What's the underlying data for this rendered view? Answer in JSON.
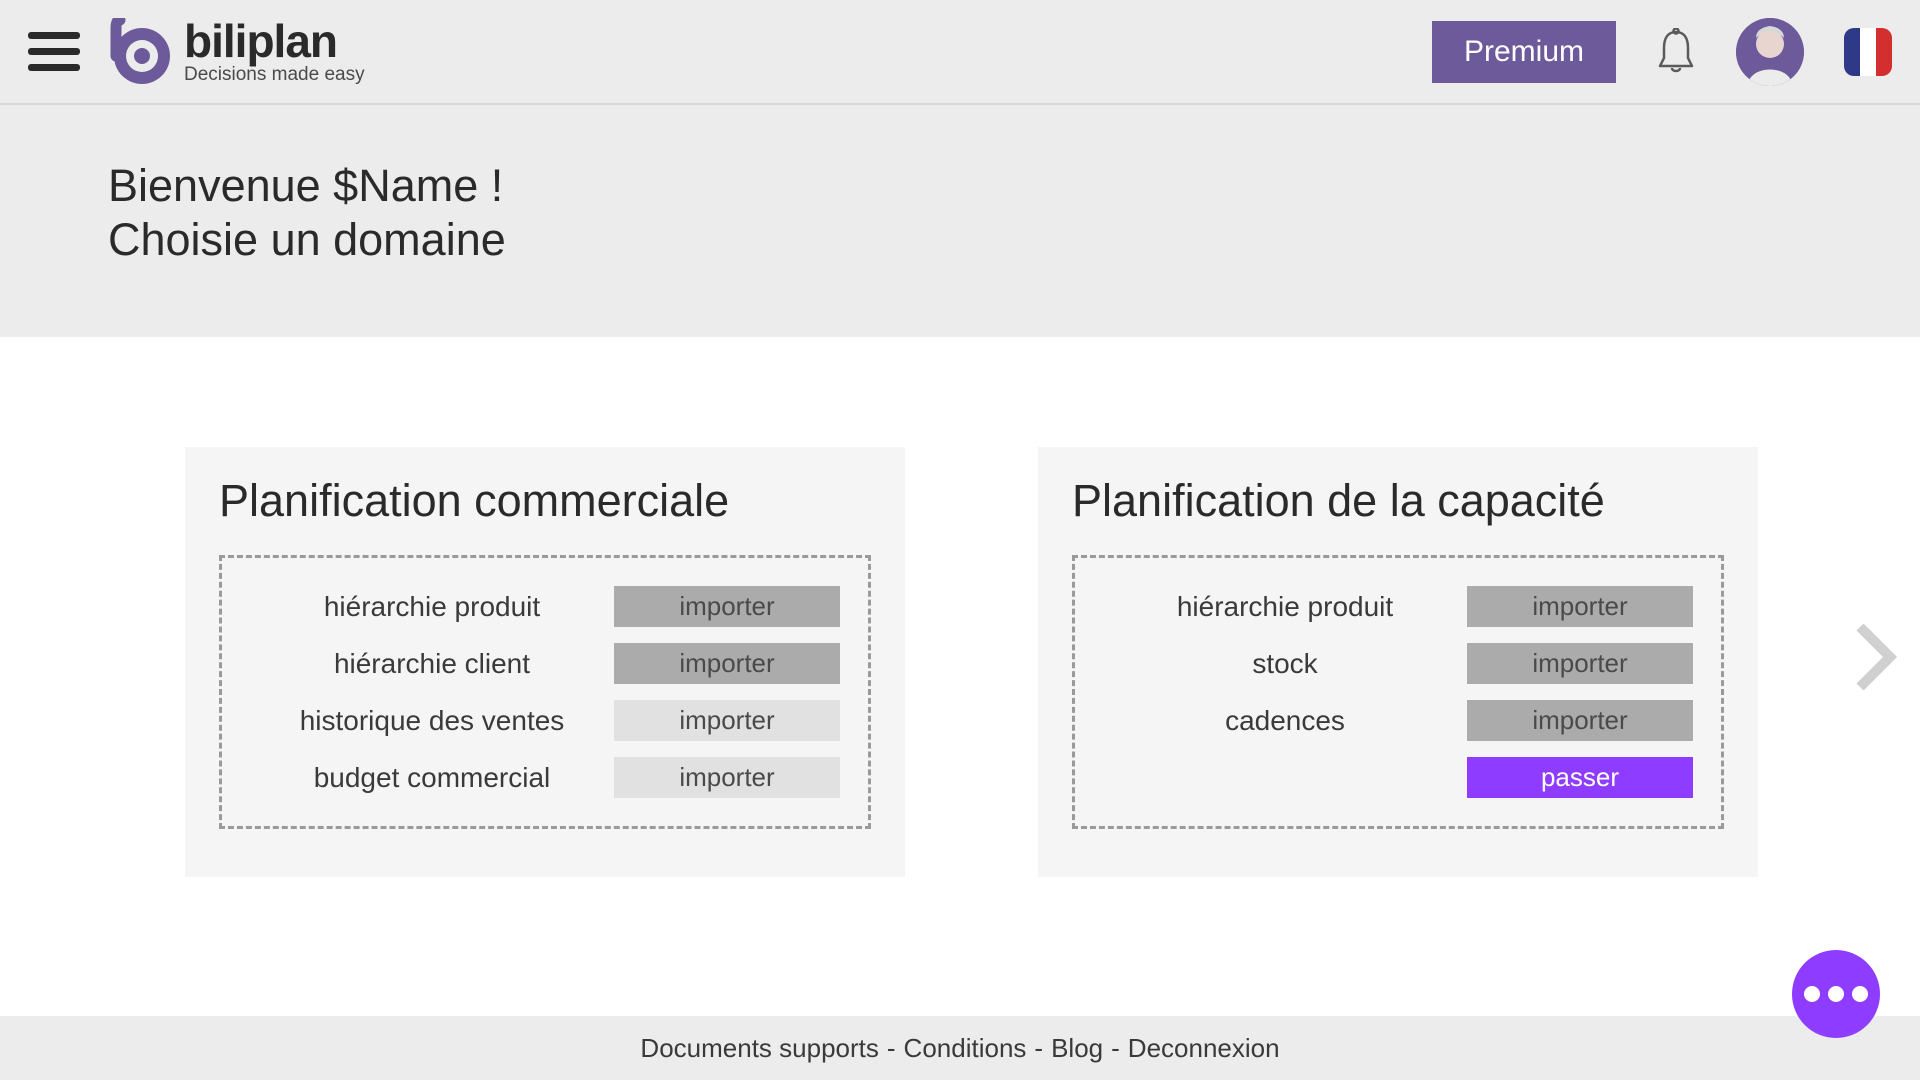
{
  "header": {
    "logo_name": "biliplan",
    "logo_tagline": "Decisions made easy",
    "premium_label": "Premium"
  },
  "welcome": {
    "line1": "Bienvenue $Name !",
    "line2": "Choisie un domaine"
  },
  "cards": [
    {
      "title": "Planification commerciale",
      "rows": [
        {
          "label": "hiérarchie produit",
          "button": "importer",
          "style": "dark"
        },
        {
          "label": "hiérarchie client",
          "button": "importer",
          "style": "dark"
        },
        {
          "label": "historique des ventes",
          "button": "importer",
          "style": "light"
        },
        {
          "label": "budget commercial",
          "button": "importer",
          "style": "light"
        }
      ]
    },
    {
      "title": "Planification de la capacité",
      "rows": [
        {
          "label": "hiérarchie produit",
          "button": "importer",
          "style": "dark"
        },
        {
          "label": "stock",
          "button": "importer",
          "style": "dark"
        },
        {
          "label": "cadences",
          "button": "importer",
          "style": "dark"
        },
        {
          "label": "",
          "button": "passer",
          "style": "purple"
        }
      ]
    }
  ],
  "footer": {
    "documents": "Documents supports",
    "conditions": "Conditions",
    "blog": "Blog",
    "logout": "Deconnexion"
  }
}
